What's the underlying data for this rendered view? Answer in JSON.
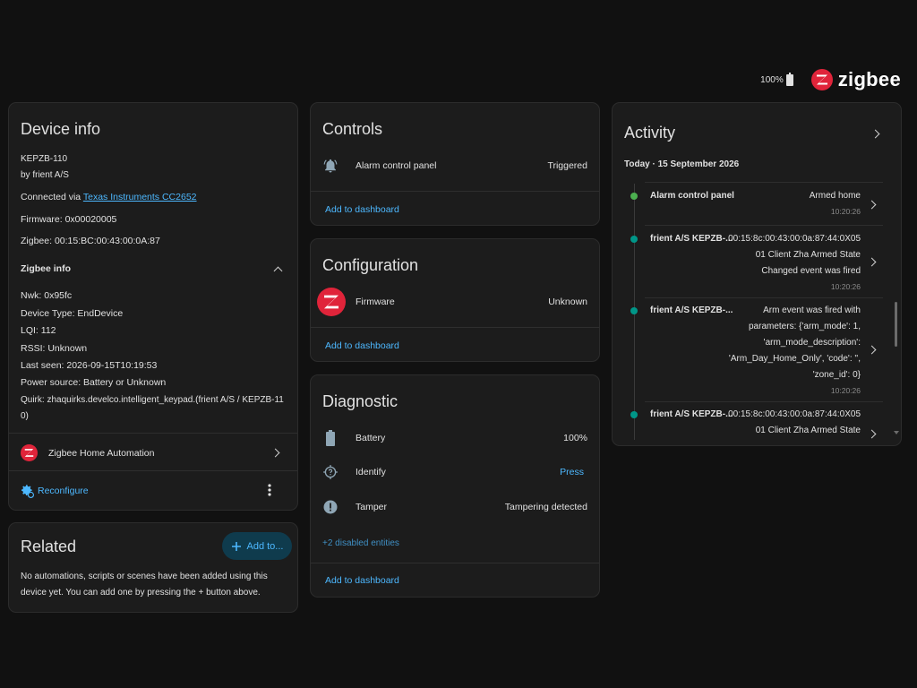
{
  "header": {
    "battery": "100%",
    "brand": "zigbee"
  },
  "device_info": {
    "title": "Device info",
    "model": "KEPZB-110",
    "manufacturer": "by frient A/S",
    "connected_prefix": "Connected via ",
    "connected_link": "Texas Instruments CC2652",
    "firmware": "Firmware: 0x00020005",
    "zigbee": "Zigbee: 00:15:BC:00:43:00:0A:87",
    "zigbee_info_title": "Zigbee info",
    "nwk": "Nwk: 0x95fc",
    "device_type": "Device Type: EndDevice",
    "lqi": "LQI: 112",
    "rssi": "RSSI: Unknown",
    "last_seen": "Last seen: 2026-09-15T10:19:53",
    "power_source": "Power source: Battery or Unknown",
    "quirk_line1": "Quirk: zhaquirks.develco.intelligent_keypad.(frient A/S / KEPZB-11",
    "quirk_line2": "0)",
    "integration": "Zigbee Home Automation",
    "reconfigure": "Reconfigure"
  },
  "related": {
    "title": "Related",
    "add_button": "Add to...",
    "description_line1": "No automations, scripts or scenes have been added using this",
    "description_line2": "device yet. You can add one by pressing the + button above."
  },
  "controls": {
    "title": "Controls",
    "entity_name": "Alarm control panel",
    "entity_state": "Triggered",
    "add_to_dashboard": "Add to dashboard"
  },
  "configuration": {
    "title": "Configuration",
    "entity_name": "Firmware",
    "entity_state": "Unknown",
    "add_to_dashboard": "Add to dashboard"
  },
  "diagnostic": {
    "title": "Diagnostic",
    "battery_name": "Battery",
    "battery_state": "100%",
    "identify_name": "Identify",
    "identify_action": "Press",
    "tamper_name": "Tamper",
    "tamper_state": "Tampering detected",
    "disabled_entities": "+2 disabled entities",
    "add_to_dashboard": "Add to dashboard"
  },
  "activity": {
    "title": "Activity",
    "date": "Today · 15 September 2026",
    "entries": [
      {
        "name": "Alarm control panel",
        "lines": [
          "Armed home"
        ],
        "time": "10:20:26",
        "color": "#4caf50"
      },
      {
        "name": "frient A/S KEPZB-...",
        "lines": [
          "00:15:8c:00:43:00:0a:87:44:0X05",
          "01 Client Zha Armed State",
          "Changed event was fired"
        ],
        "time": "10:20:26",
        "color": "#009688"
      },
      {
        "name": "frient A/S KEPZB-...",
        "lines": [
          "Arm event was fired with",
          "parameters: {'arm_mode': 1,",
          "'arm_mode_description':",
          "'Arm_Day_Home_Only', 'code': '',",
          "'zone_id': 0}"
        ],
        "time": "10:20:26",
        "color": "#009688"
      },
      {
        "name": "frient A/S KEPZB-...",
        "lines": [
          "00:15:8c:00:43:00:0a:87:44:0X05",
          "01 Client Zha Armed State"
        ],
        "time": "",
        "color": "#009688"
      }
    ]
  },
  "colors": {
    "background": "#111111",
    "card": "#1c1c1c",
    "accent": "#4db8ff",
    "zigbee_red": "#e0243a"
  },
  "icons": {
    "battery_status": "battery-full-icon",
    "alarm": "bell-ring-icon",
    "battery_entity": "battery-icon",
    "identify": "crosshairs-question-icon",
    "tamper": "alert-circle-icon",
    "reconfigure": "cog-refresh-icon",
    "more": "dots-vertical-icon",
    "add": "plus-icon"
  }
}
